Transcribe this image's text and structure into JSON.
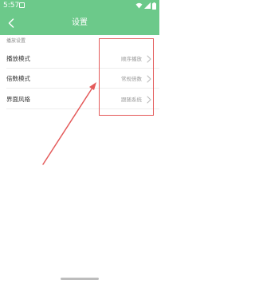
{
  "status_bar": {
    "time": "5:57",
    "icons": [
      "notification-icon",
      "wifi-icon",
      "signal-icon",
      "battery-icon"
    ]
  },
  "header": {
    "title": "设置",
    "back_icon": "back-arrow-icon"
  },
  "section": {
    "title": "播放设置",
    "rows": [
      {
        "label": "播放模式",
        "value": "顺序播放"
      },
      {
        "label": "倍数模式",
        "value": "常规倍数"
      },
      {
        "label": "界面风格",
        "value": "跟随系统"
      }
    ]
  },
  "annotation": {
    "color": "#e45a5a"
  },
  "theme": {
    "accent": "#6cc98a"
  }
}
